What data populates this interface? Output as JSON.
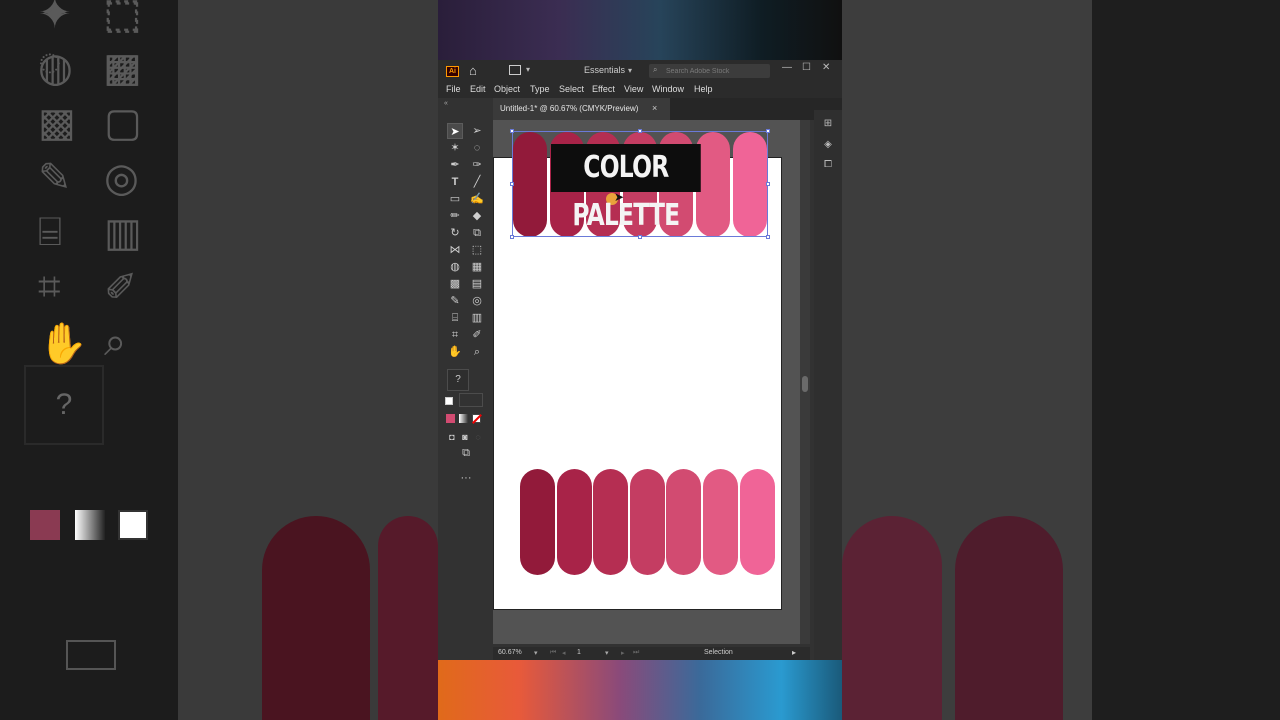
{
  "window": {
    "app_logo": "Ai",
    "workspace": "Essentials",
    "search_placeholder": "Search Adobe Stock",
    "minimize": "—",
    "maximize": "☐",
    "close": "✕"
  },
  "menu": [
    "File",
    "Edit",
    "Object",
    "Type",
    "Select",
    "Effect",
    "View",
    "Window",
    "Help"
  ],
  "document_tab": {
    "title": "Untitled-1* @ 60.67% (CMYK/Preview)",
    "close": "×"
  },
  "overlay_title": "COLOR PALETTE",
  "palette_colors": [
    "#921a3a",
    "#a82348",
    "#b52e52",
    "#c43d62",
    "#d24b71",
    "#e25a83",
    "#f06497"
  ],
  "statusbar": {
    "zoom": "60.67%",
    "artboard_number": "1",
    "tool": "Selection"
  },
  "toolbar": {
    "help": "?",
    "more": "···"
  },
  "colors": {
    "fill_swatch": "#d24b71",
    "selection": "#6a7ad8"
  }
}
